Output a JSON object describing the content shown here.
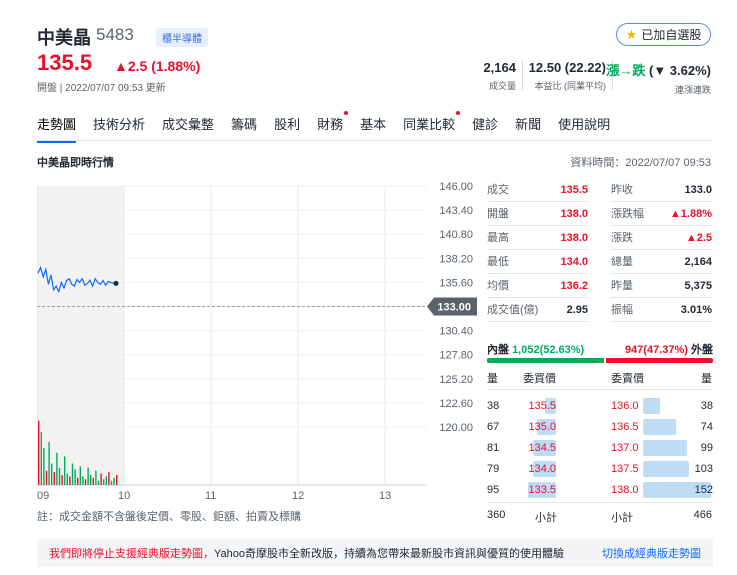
{
  "header": {
    "name": "中美晶",
    "code": "5483",
    "tag": "櫃半導體",
    "price": "135.5",
    "change": "▲2.5 (1.88%)",
    "status": "開盤 | 2022/07/07 09:53 更新",
    "watch_label": "已加自選股",
    "stats": [
      {
        "value": "2,164",
        "label": "成交量"
      },
      {
        "value": "12.50 (22.22)",
        "label": "本益比 (同業平均)"
      },
      {
        "value_prefix": "漲→跌",
        "value_change": "(▼ 3.62%)",
        "label": "連漲連跌"
      }
    ]
  },
  "nav": {
    "tabs": [
      "走勢圖",
      "技術分析",
      "成交彙整",
      "籌碼",
      "股利",
      "財務",
      "基本",
      "同業比較",
      "健診",
      "新聞",
      "使用說明"
    ],
    "active": 0,
    "dots": [
      5,
      7
    ]
  },
  "section": {
    "title": "中美晶即時行情",
    "time": "資料時間：2022/07/07 09:53"
  },
  "chart_data": {
    "type": "line",
    "y_ticks": [
      "146.00",
      "143.40",
      "140.80",
      "138.20",
      "135.60",
      "133.00",
      "130.40",
      "127.80",
      "125.20",
      "122.60",
      "120.00"
    ],
    "ylim": [
      120.0,
      146.0
    ],
    "x_ticks": [
      "09",
      "10",
      "11",
      "12",
      "13"
    ],
    "reference_price": 133.0,
    "reference_label": "133.00",
    "price_series": [
      136.6,
      137.2,
      136.2,
      137.0,
      135.4,
      136.4,
      134.8,
      135.2,
      134.6,
      135.6,
      135.0,
      135.8,
      136.0,
      135.4,
      135.2,
      135.9,
      135.6,
      136.0,
      135.3,
      135.5,
      135.8,
      135.2,
      136.0,
      135.6,
      135.4,
      135.8,
      135.3,
      135.7,
      135.6,
      135.5,
      135.5
    ],
    "volume_series": [
      90,
      74,
      52,
      20,
      60,
      30,
      18,
      45,
      24,
      14,
      40,
      16,
      12,
      30,
      22,
      10,
      26,
      12,
      8,
      24,
      14,
      10,
      20,
      6,
      16,
      8,
      12,
      18,
      6,
      10,
      14
    ]
  },
  "note": "註：成交金額不含盤後定價、零股、鉅額、拍賣及標購",
  "quote": {
    "left": [
      {
        "label": "成交",
        "value": "135.5",
        "color": "red"
      },
      {
        "label": "開盤",
        "value": "138.0",
        "color": "red"
      },
      {
        "label": "最高",
        "value": "138.0",
        "color": "red"
      },
      {
        "label": "最低",
        "value": "134.0",
        "color": "red"
      },
      {
        "label": "均價",
        "value": "136.2",
        "color": "red"
      },
      {
        "label": "成交值(億)",
        "value": "2.95",
        "color": "black"
      }
    ],
    "right": [
      {
        "label": "昨收",
        "value": "133.0",
        "color": "black"
      },
      {
        "label": "漲跌幅",
        "value": "▲1.88%",
        "color": "red"
      },
      {
        "label": "漲跌",
        "value": "▲2.5",
        "color": "red"
      },
      {
        "label": "總量",
        "value": "2,164",
        "color": "black"
      },
      {
        "label": "昨量",
        "value": "5,375",
        "color": "black"
      },
      {
        "label": "振幅",
        "value": "3.01%",
        "color": "black"
      }
    ]
  },
  "inout": {
    "inner_label": "內盤",
    "inner_value": "1,052(52.63%)",
    "outer_value": "947(47.37%)",
    "outer_label": "外盤",
    "inner_fraction": 0.5263
  },
  "book": {
    "headers": [
      "量",
      "委買價",
      "委賣價",
      "量"
    ],
    "rows": [
      {
        "bid_vol": "38",
        "bid": "135.5",
        "ask": "136.0",
        "ask_vol": "38",
        "bid_fill": 0.25,
        "ask_fill": 0.25
      },
      {
        "bid_vol": "67",
        "bid": "135.0",
        "ask": "136.5",
        "ask_vol": "74",
        "bid_fill": 0.44,
        "ask_fill": 0.49
      },
      {
        "bid_vol": "81",
        "bid": "134.5",
        "ask": "137.0",
        "ask_vol": "99",
        "bid_fill": 0.53,
        "ask_fill": 0.65
      },
      {
        "bid_vol": "79",
        "bid": "134.0",
        "ask": "137.5",
        "ask_vol": "103",
        "bid_fill": 0.52,
        "ask_fill": 0.68
      },
      {
        "bid_vol": "95",
        "bid": "133.5",
        "ask": "138.0",
        "ask_vol": "152",
        "bid_fill": 0.63,
        "ask_fill": 1.0
      }
    ],
    "total_bid": "360",
    "subtotal_label": "小計",
    "total_ask": "466"
  },
  "notice": {
    "highlight": "我們即將停止支援經典版走勢圖，",
    "text": "Yahoo奇摩股市全新改版，持續為您帶來最新股市資訊與優質的使用體驗",
    "link": "切換成經典版走勢圖"
  },
  "colors": {
    "red": "#eb0f29",
    "green": "#00ab5e",
    "blue": "#0f69ff",
    "bar": "#bfdcf6"
  }
}
